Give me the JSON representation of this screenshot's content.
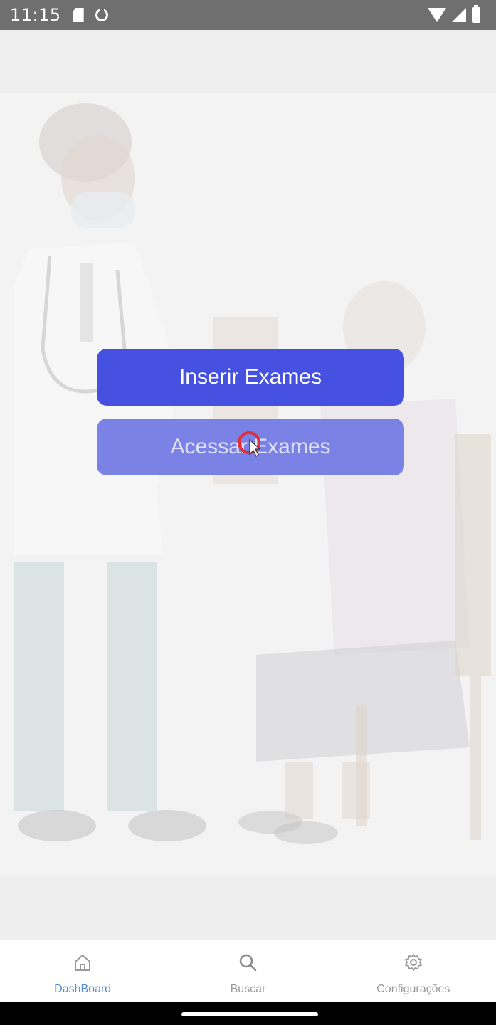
{
  "status_bar": {
    "time": "11:15",
    "left_icons": [
      "sd-card-icon",
      "ring-icon"
    ],
    "right_icons": [
      "wifi-icon",
      "signal-icon",
      "battery-icon"
    ]
  },
  "main": {
    "buttons": {
      "insert_label": "Inserir Exames",
      "access_label": "Acessar Exames"
    }
  },
  "bottom_nav": {
    "items": [
      {
        "label": "DashBoard",
        "icon": "home-icon",
        "active": true
      },
      {
        "label": "Buscar",
        "icon": "search-icon",
        "active": false
      },
      {
        "label": "Configurações",
        "icon": "gear-icon",
        "active": false
      }
    ]
  },
  "colors": {
    "primary": "#4651e1",
    "primary_light": "#7b82e6",
    "active_nav": "#4f8fd6",
    "status_bar": "#6f6f6f"
  }
}
